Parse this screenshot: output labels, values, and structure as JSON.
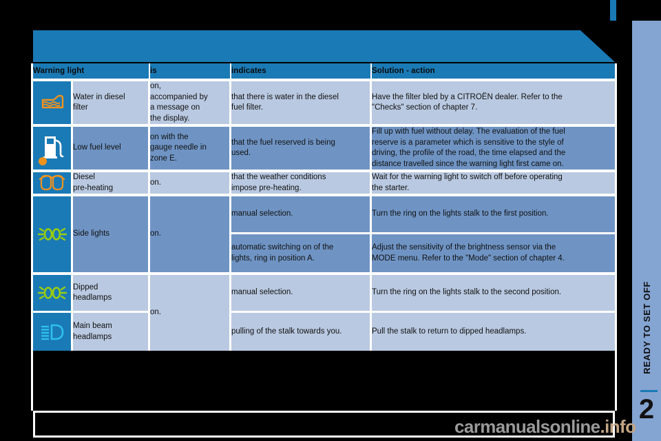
{
  "table": {
    "headers": [
      "Warning light",
      "is",
      "indicates",
      "Solution - action"
    ],
    "rows": [
      {
        "icon": "water-in-diesel-filter-icon",
        "name": "Water in diesel\nfilter",
        "is": "on,\naccompanied by\na message on\nthe display.",
        "indicates": "that there is water in the diesel\nfuel filter.",
        "solution": "Have the filter bled by a CITROËN dealer. Refer to the\n\"Checks\" section of chapter 7.",
        "shade": "light"
      },
      {
        "icon": "low-fuel-level-icon",
        "name": "Low fuel level",
        "is": "on with the\ngauge needle in\nzone E.",
        "indicates": "that the fuel reserved is being\nused.",
        "solution": "Fill up with fuel without delay. The evaluation of the fuel\nreserve is a parameter which is sensitive to the style of\ndriving, the profile of the road, the time elapsed and the\ndistance travelled since the warning light first came on.",
        "shade": "mid"
      },
      {
        "icon": "diesel-preheating-icon",
        "name": "Diesel\npre-heating",
        "is": "on.",
        "indicates": "that the weather conditions\nimpose pre-heating.",
        "solution": "Wait for the warning light to switch off before operating\nthe starter.",
        "shade": "light"
      },
      {
        "icon": "side-lights-icon",
        "name": "Side lights",
        "is": "on.",
        "shade": "mid",
        "sub": [
          {
            "indicates": "manual selection.",
            "solution": "Turn the ring on the lights stalk to the first position."
          },
          {
            "indicates": "automatic switching on of the\nlights, ring in position A.",
            "solution": "Adjust the sensitivity of the brightness sensor via the\nMODE menu. Refer to the \"Mode\" section of chapter 4."
          }
        ]
      },
      {
        "icon": "dipped-headlamps-icon",
        "name": "Dipped\nheadlamps",
        "is": "on.",
        "shade": "light",
        "sub": [
          {
            "indicates": "manual selection.",
            "solution": "Turn the ring on the lights stalk to the second position."
          }
        ]
      },
      {
        "icon": "main-beam-headlamps-icon",
        "name": "Main beam\nheadlamps",
        "is": "",
        "shade": "light",
        "sub": [
          {
            "indicates": "pulling of the stalk towards you.",
            "solution": "Pull the stalk to return to dipped headlamps."
          }
        ]
      }
    ]
  },
  "sidebar": {
    "section_title": "READY TO SET OFF",
    "chapter_number": "2"
  },
  "watermark": {
    "name": "carmanualsonline",
    "tld": ".info"
  },
  "colors": {
    "accent_blue": "#1a7ab5",
    "row_light": "#b9c9e1",
    "row_mid": "#6f94c4",
    "sidebar": "#84a4d2",
    "icon_orange": "#f0921e",
    "icon_green": "#9acd10",
    "icon_cyan": "#2ec0ee",
    "icon_white": "#ffffff"
  }
}
